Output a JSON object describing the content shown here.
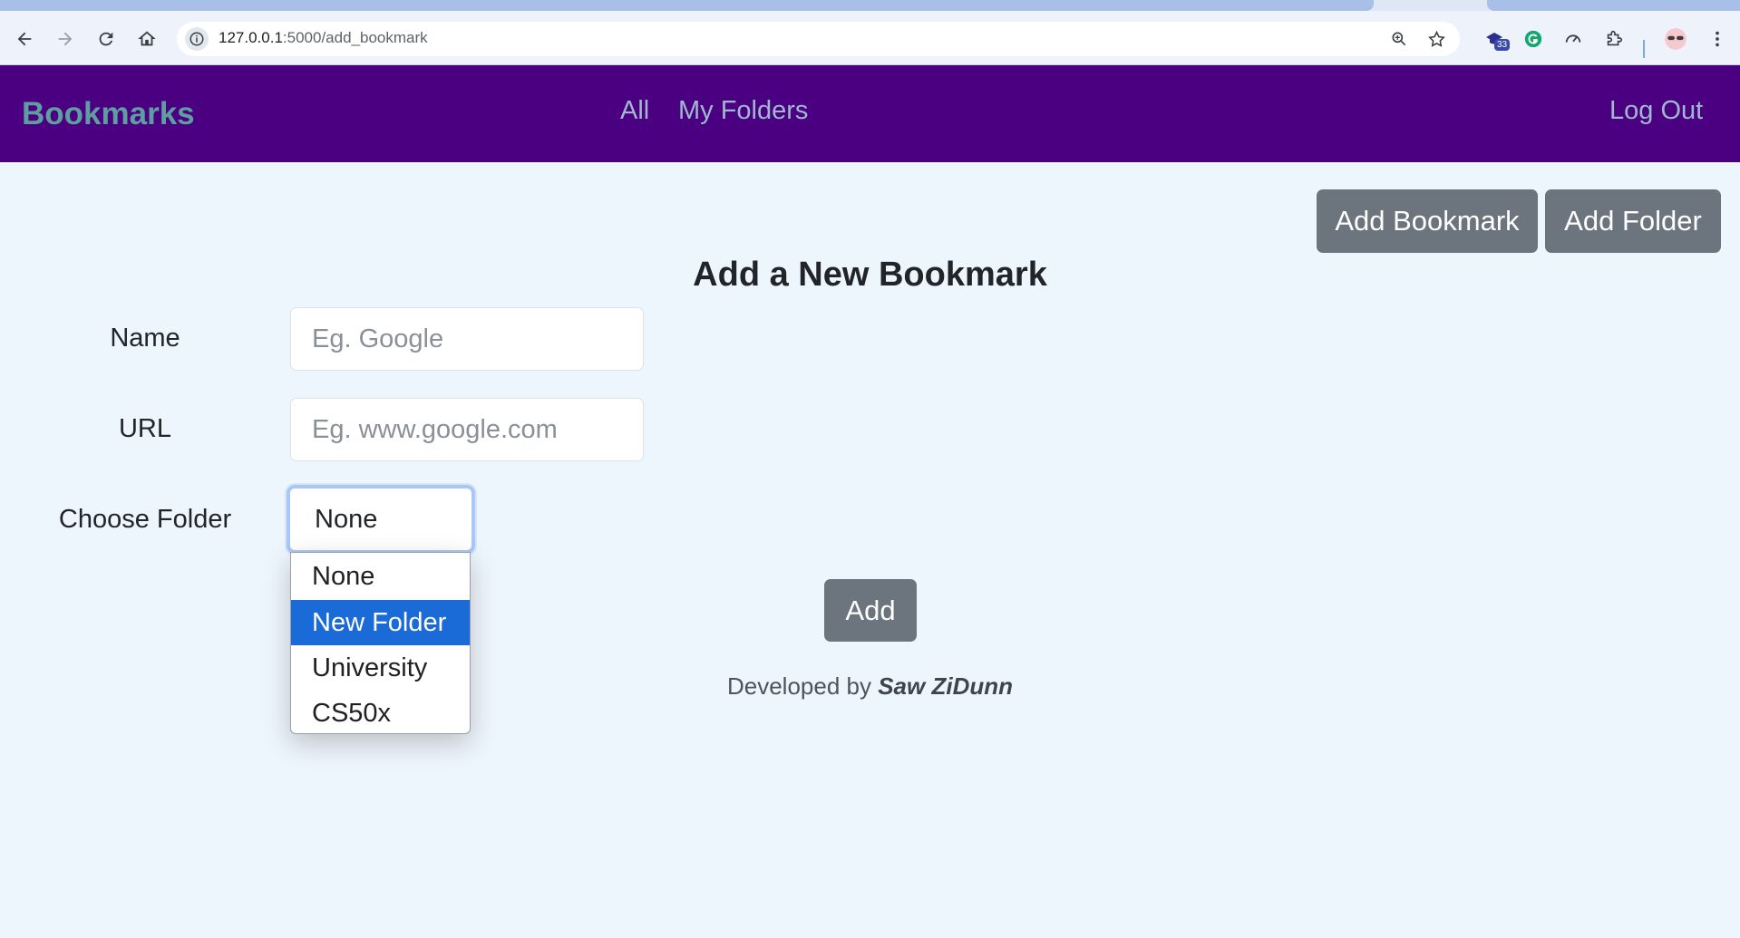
{
  "browser": {
    "url_host": "127.0.0.1",
    "url_path": ":5000/add_bookmark",
    "extension_badge": "33"
  },
  "navbar": {
    "brand": "Bookmarks",
    "links": [
      "All",
      "My Folders"
    ],
    "logout": "Log Out",
    "background_color": "#4b0082",
    "brand_color": "#5f9ea0"
  },
  "actions": {
    "add_bookmark": "Add Bookmark",
    "add_folder": "Add Folder"
  },
  "form": {
    "title": "Add a New Bookmark",
    "name_label": "Name",
    "name_placeholder": "Eg. Google",
    "url_label": "URL",
    "url_placeholder": "Eg. www.google.com",
    "folder_label": "Choose Folder",
    "folder_value": "None",
    "folder_options": [
      "None",
      "New Folder",
      "University",
      "CS50x"
    ],
    "highlighted_option": "New Folder",
    "submit": "Add"
  },
  "footer": {
    "prefix": "Developed by",
    "author": "Saw ZiDunn"
  }
}
